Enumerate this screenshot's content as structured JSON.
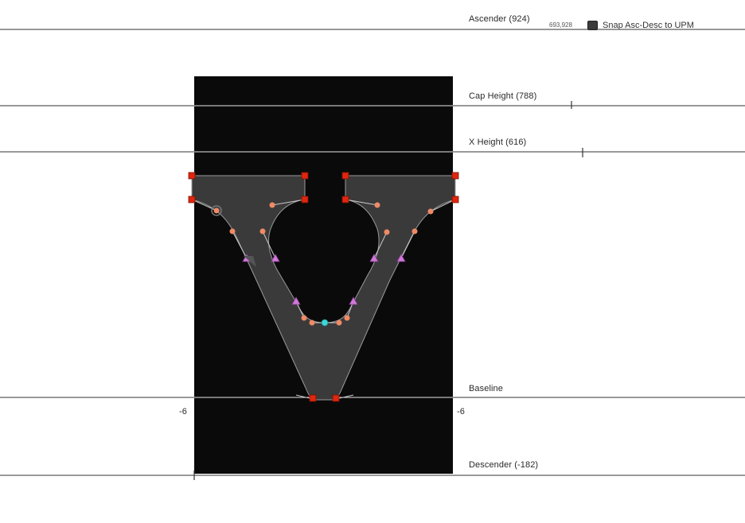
{
  "guides": {
    "ascender": "Ascender (924)",
    "cap_height": "Cap Height (788)",
    "x_height": "X Height (616)",
    "baseline": "Baseline",
    "descender": "Descender (-182)"
  },
  "sidebearings": {
    "left": "-6",
    "right": "-6"
  },
  "snap": {
    "coord_readout": "693,928",
    "label": "Snap Asc-Desc to UPM",
    "checked": true
  },
  "colors": {
    "background": "#ffffff",
    "glyph_box": "#0a0a0a",
    "glyph_fill": "#3a3a3a",
    "on_curve_point": "#e0260f",
    "off_curve_point": "#ef8a66",
    "smooth_point": "#d07ad8",
    "start_point": "#3fd7d7",
    "guide_line": "#333333"
  },
  "glyph": {
    "name": "v",
    "icon": "glyph-outline-v"
  }
}
